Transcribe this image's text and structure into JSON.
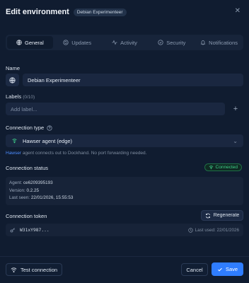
{
  "header": {
    "title": "Edit environment",
    "badge": "Debian Experimenteer"
  },
  "tabs": [
    {
      "label": "General",
      "icon": "globe-icon",
      "active": true
    },
    {
      "label": "Updates",
      "icon": "refresh-icon",
      "active": false
    },
    {
      "label": "Activity",
      "icon": "activity-icon",
      "active": false
    },
    {
      "label": "Security",
      "icon": "shield-icon",
      "active": false
    },
    {
      "label": "Notifications",
      "icon": "bell-icon",
      "active": false
    }
  ],
  "name": {
    "label": "Name",
    "value": "Debian Experimenteer"
  },
  "labels": {
    "label": "Labels",
    "count": "(0/10)",
    "placeholder": "Add label..."
  },
  "connection_type": {
    "label": "Connection type",
    "value": "Hawser agent (edge)"
  },
  "hint": {
    "link": "Hawser",
    "text": " agent connects out to Dockhand. No port forwarding needed."
  },
  "status": {
    "label": "Connection status",
    "pill": "Connected",
    "agent_key": "Agent: ",
    "agent": "ce6209395193",
    "version_key": "Version: ",
    "version": "0.2.25",
    "last_seen_key": "Last seen: ",
    "last_seen": "22/01/2026, 15:55:53"
  },
  "token": {
    "label": "Connection token",
    "regenerate": "Regenerate",
    "value": "W31xY987...",
    "last_used": "Last used: 22/01/2026"
  },
  "footer": {
    "test": "Test connection",
    "cancel": "Cancel",
    "save": "Save"
  },
  "colors": {
    "accent": "#2f7dff",
    "success": "#3fd08a",
    "background": "#101c30"
  }
}
